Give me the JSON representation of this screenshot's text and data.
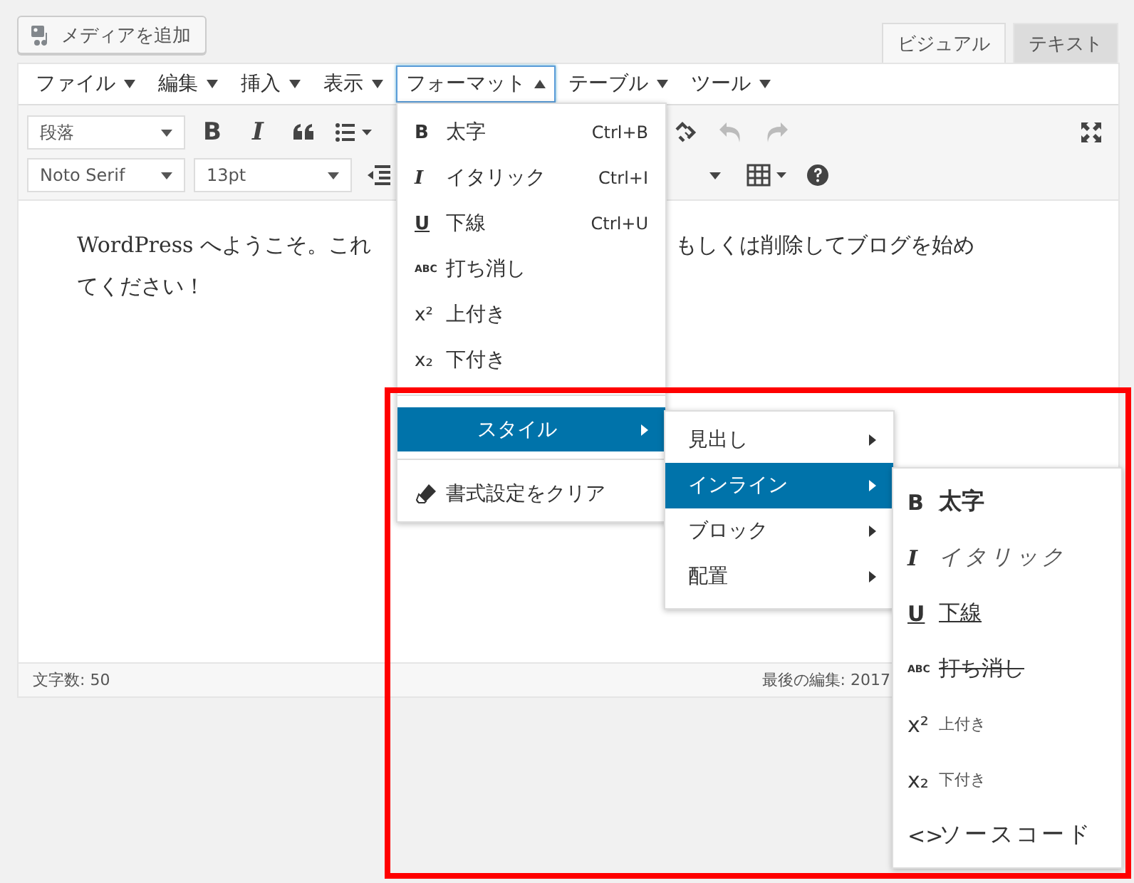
{
  "media_button": {
    "label": "メディアを追加"
  },
  "editor_tabs": [
    {
      "label": "ビジュアル",
      "selected": true
    },
    {
      "label": "テキスト",
      "selected": false
    }
  ],
  "menubar": [
    {
      "label": "ファイル",
      "selected": false
    },
    {
      "label": "編集",
      "selected": false
    },
    {
      "label": "挿入",
      "selected": false
    },
    {
      "label": "表示",
      "selected": false
    },
    {
      "label": "フォーマット",
      "selected": true
    },
    {
      "label": "テーブル",
      "selected": false
    },
    {
      "label": "ツール",
      "selected": false
    }
  ],
  "toolbar_row_1": {
    "select": "段落",
    "buttons": [
      {
        "kind": "glyph",
        "glyph": "B",
        "disabled": false
      },
      {
        "kind": "glyph-italic",
        "glyph": "I",
        "disabled": false
      },
      {
        "kind": "quote",
        "disabled": false
      },
      {
        "kind": "list",
        "disabled": false
      },
      {
        "kind": "unlink",
        "disabled": false
      },
      {
        "kind": "undo",
        "disabled": true
      },
      {
        "kind": "redo",
        "disabled": true
      }
    ]
  },
  "toolbar_row_2": {
    "font": "Noto Serif",
    "size": "13pt"
  },
  "content": {
    "line_1_start": "WordPress へようこそ。これ",
    "line_1_end": "もしくは削除してブログを始め",
    "line_2": "てください！"
  },
  "status_bar": {
    "word_count": "文字数: 50",
    "last_edited": "最後の編集: 2017"
  },
  "format_menu": [
    {
      "kind": "bold",
      "icon": "B",
      "label": "太字",
      "shortcut": "Ctrl+B"
    },
    {
      "kind": "italic",
      "icon": "I",
      "label": "イタリック",
      "shortcut": "Ctrl+I"
    },
    {
      "kind": "underline",
      "icon": "U",
      "label": "下線",
      "shortcut": "Ctrl+U"
    },
    {
      "kind": "strike",
      "icon": "ABC",
      "label": "打ち消し"
    },
    {
      "kind": "sup",
      "icon": "x²",
      "label": "上付き"
    },
    {
      "kind": "sub",
      "icon": "x₂",
      "label": "下付き"
    },
    {
      "kind": "submenu",
      "label": "スタイル",
      "selected": true
    },
    {
      "kind": "clear",
      "label": "書式設定をクリア"
    }
  ],
  "style_submenu": [
    {
      "label": "見出し",
      "selected": false
    },
    {
      "label": "インライン",
      "selected": true
    },
    {
      "label": "ブロック",
      "selected": false
    },
    {
      "label": "配置",
      "selected": false
    }
  ],
  "inline_submenu": [
    {
      "kind": "bold",
      "icon": "B",
      "label": "太字"
    },
    {
      "kind": "italic",
      "icon": "I",
      "label": "イタリック"
    },
    {
      "kind": "underline",
      "icon": "U",
      "label": "下線"
    },
    {
      "kind": "strike",
      "icon": "ABC",
      "label": "打ち消し"
    },
    {
      "kind": "sup",
      "icon": "x²",
      "label": "上付き"
    },
    {
      "kind": "sub",
      "icon": "x₂",
      "label": "下付き"
    },
    {
      "kind": "code",
      "icon": "<>",
      "label": "ソースコード"
    }
  ],
  "highlight": {
    "kind": "frame"
  }
}
